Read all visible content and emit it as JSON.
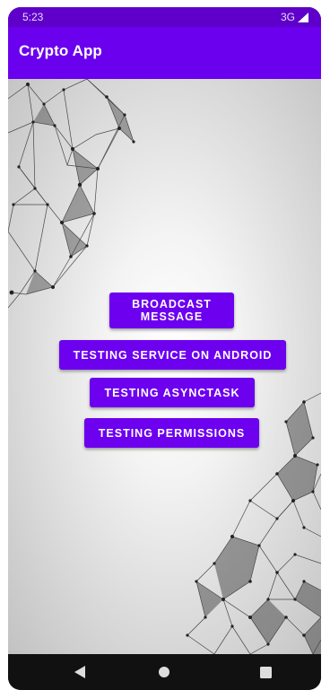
{
  "status_bar": {
    "time": "5:23",
    "network": "3G"
  },
  "app_bar": {
    "title": "Crypto App"
  },
  "buttons": {
    "broadcast": "BROADCAST MESSAGE",
    "service": "TESTING SERVICE ON ANDROID",
    "asynctask": "TESTING ASYNCTASK",
    "permissions": "TESTING PERMISSIONS"
  },
  "nav_bar": {
    "icons": [
      "back-icon",
      "home-icon",
      "recents-icon"
    ]
  },
  "colors": {
    "status_bar": "#5e00c9",
    "app_bar": "#6a00ee",
    "button": "#6c00ef",
    "nav_bar": "#111111"
  }
}
